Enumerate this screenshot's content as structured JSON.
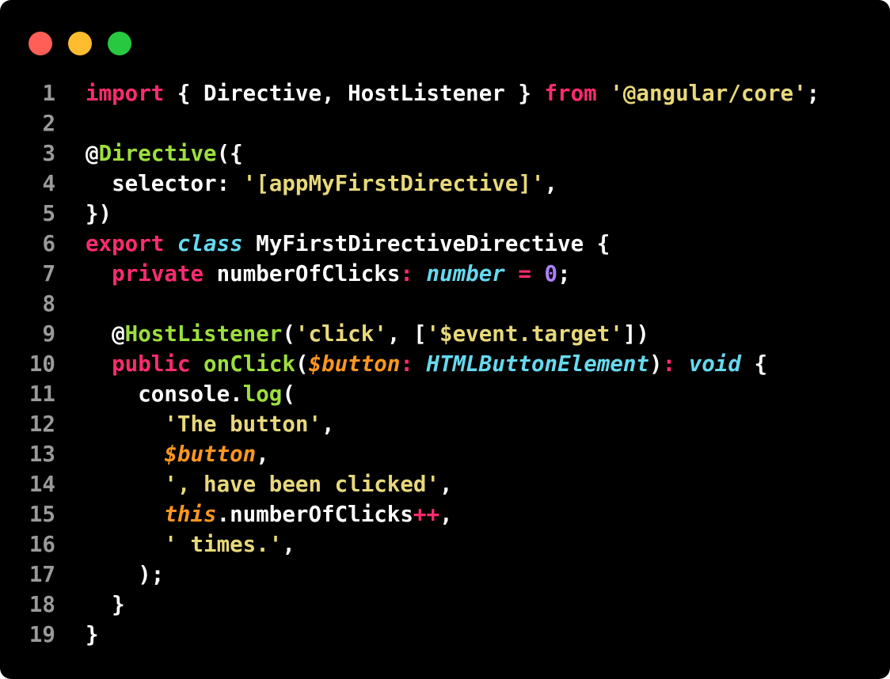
{
  "window_controls": {
    "close_color": "#ff5f57",
    "minimize_color": "#febc2e",
    "maximize_color": "#28c840"
  },
  "colors": {
    "background": "#000000",
    "keyword": "#ff2b6f",
    "string": "#e8d87a",
    "function": "#9ddf3c",
    "type": "#66d9ef",
    "parameter": "#fd971f",
    "number": "#ae81ff",
    "line_number": "#9a9a9a"
  },
  "code": {
    "language": "typescript",
    "lines": [
      {
        "n": "1",
        "tokens": [
          [
            "kw",
            "import"
          ],
          [
            "p",
            " { Directive, HostListener } "
          ],
          [
            "kw",
            "from"
          ],
          [
            "p",
            " "
          ],
          [
            "str",
            "'@angular/core'"
          ],
          [
            "p",
            ";"
          ]
        ]
      },
      {
        "n": "2",
        "tokens": []
      },
      {
        "n": "3",
        "tokens": [
          [
            "p",
            "@"
          ],
          [
            "fn",
            "Directive"
          ],
          [
            "p",
            "({"
          ]
        ]
      },
      {
        "n": "4",
        "tokens": [
          [
            "p",
            "  selector: "
          ],
          [
            "str",
            "'[appMyFirstDirective]'"
          ],
          [
            "p",
            ","
          ]
        ]
      },
      {
        "n": "5",
        "tokens": [
          [
            "p",
            "})"
          ]
        ]
      },
      {
        "n": "6",
        "tokens": [
          [
            "kw",
            "export"
          ],
          [
            "p",
            " "
          ],
          [
            "type",
            "class"
          ],
          [
            "p",
            " MyFirstDirectiveDirective {"
          ]
        ]
      },
      {
        "n": "7",
        "tokens": [
          [
            "p",
            "  "
          ],
          [
            "kw",
            "private"
          ],
          [
            "p",
            " numberOfClicks"
          ],
          [
            "kw",
            ":"
          ],
          [
            "p",
            " "
          ],
          [
            "type",
            "number"
          ],
          [
            "p",
            " "
          ],
          [
            "kw",
            "="
          ],
          [
            "p",
            " "
          ],
          [
            "num",
            "0"
          ],
          [
            "p",
            ";"
          ]
        ]
      },
      {
        "n": "8",
        "tokens": []
      },
      {
        "n": "9",
        "tokens": [
          [
            "p",
            "  @"
          ],
          [
            "fn",
            "HostListener"
          ],
          [
            "p",
            "("
          ],
          [
            "str",
            "'click'"
          ],
          [
            "p",
            ", ["
          ],
          [
            "str",
            "'$event.target'"
          ],
          [
            "p",
            "])"
          ]
        ]
      },
      {
        "n": "10",
        "tokens": [
          [
            "p",
            "  "
          ],
          [
            "kw",
            "public"
          ],
          [
            "p",
            " "
          ],
          [
            "fn",
            "onClick"
          ],
          [
            "p",
            "("
          ],
          [
            "param",
            "$button"
          ],
          [
            "kw",
            ":"
          ],
          [
            "p",
            " "
          ],
          [
            "type",
            "HTMLButtonElement"
          ],
          [
            "p",
            ")"
          ],
          [
            "kw",
            ":"
          ],
          [
            "p",
            " "
          ],
          [
            "type",
            "void"
          ],
          [
            "p",
            " {"
          ]
        ]
      },
      {
        "n": "11",
        "tokens": [
          [
            "p",
            "    console."
          ],
          [
            "fn",
            "log"
          ],
          [
            "p",
            "("
          ]
        ]
      },
      {
        "n": "12",
        "tokens": [
          [
            "p",
            "      "
          ],
          [
            "str",
            "'The button'"
          ],
          [
            "p",
            ","
          ]
        ]
      },
      {
        "n": "13",
        "tokens": [
          [
            "p",
            "      "
          ],
          [
            "param",
            "$button"
          ],
          [
            "p",
            ","
          ]
        ]
      },
      {
        "n": "14",
        "tokens": [
          [
            "p",
            "      "
          ],
          [
            "str",
            "', have been clicked'"
          ],
          [
            "p",
            ","
          ]
        ]
      },
      {
        "n": "15",
        "tokens": [
          [
            "p",
            "      "
          ],
          [
            "param",
            "this"
          ],
          [
            "p",
            ".numberOfClicks"
          ],
          [
            "kw",
            "++"
          ],
          [
            "p",
            ","
          ]
        ]
      },
      {
        "n": "16",
        "tokens": [
          [
            "p",
            "      "
          ],
          [
            "str",
            "' times.'"
          ],
          [
            "p",
            ","
          ]
        ]
      },
      {
        "n": "17",
        "tokens": [
          [
            "p",
            "    );"
          ]
        ]
      },
      {
        "n": "18",
        "tokens": [
          [
            "p",
            "  }"
          ]
        ]
      },
      {
        "n": "19",
        "tokens": [
          [
            "p",
            "}"
          ]
        ]
      }
    ]
  }
}
